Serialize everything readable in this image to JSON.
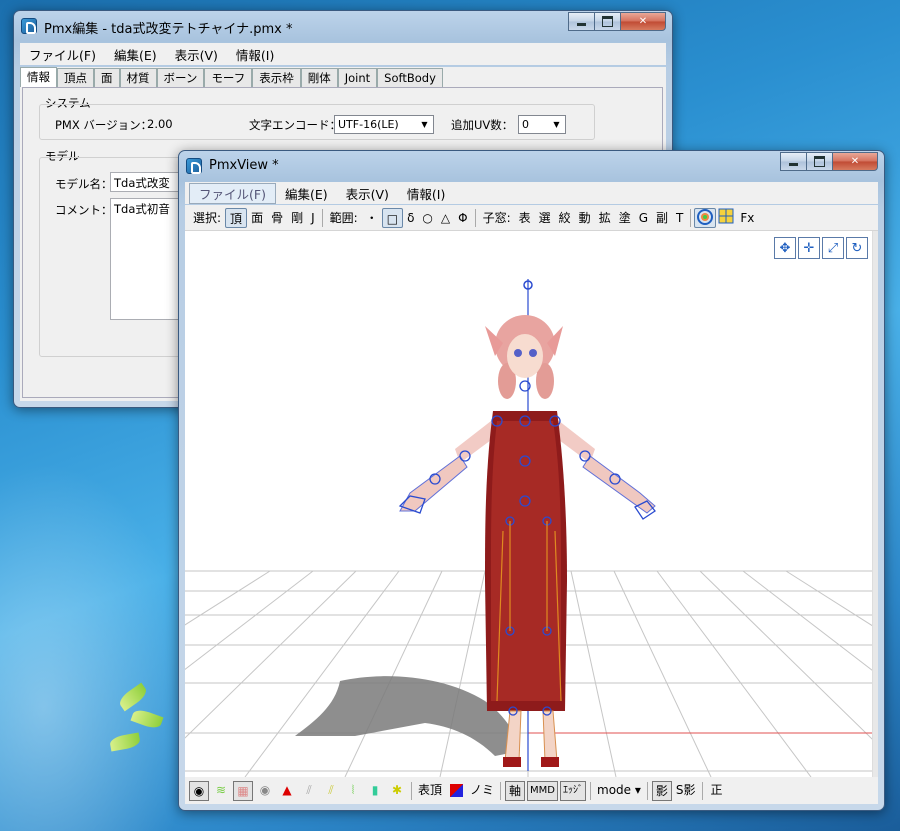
{
  "editor": {
    "title": "Pmx編集 - tda式改変テトチャイナ.pmx *",
    "menu": [
      "ファイル(F)",
      "編集(E)",
      "表示(V)",
      "情報(I)"
    ],
    "tabs": [
      "情報",
      "頂点",
      "面",
      "材質",
      "ボーン",
      "モーフ",
      "表示枠",
      "剛体",
      "Joint",
      "SoftBody"
    ],
    "system_group": "システム",
    "pmx_version_label": "PMX バージョン：",
    "pmx_version_value": "2.00",
    "encoding_label": "文字エンコード：",
    "encoding_value": "UTF-16(LE)",
    "uv_label": "追加UV数：",
    "uv_value": "0",
    "model_group": "モデル",
    "model_name_label": "モデル名：",
    "model_name_value": "Tda式改変",
    "comment_label": "コメント：",
    "comment_value": "Tda式初音"
  },
  "viewer": {
    "title": "PmxView *",
    "menu": [
      "ファイル(F)",
      "編集(E)",
      "表示(V)",
      "情報(I)"
    ],
    "toolbar": {
      "select_label": "選択:",
      "select_items": [
        "頂",
        "面",
        "骨",
        "剛",
        "J"
      ],
      "range_label": "範囲:",
      "range_items": [
        "・",
        "□",
        "δ",
        "○",
        "△",
        "Φ"
      ],
      "child_label": "子窓:",
      "child_items": [
        "表",
        "選",
        "絞",
        "動",
        "拡",
        "塗",
        "G",
        "副",
        "T"
      ],
      "fx_label": "Fx"
    },
    "bottombar": {
      "surface_label": "表頂",
      "nomi_label": "ノミ",
      "axis_label": "軸",
      "mmd_label": "MMD",
      "edge_label": "ｴｯｼﾞ",
      "mode_label": "mode ▾",
      "shadow_label": "影",
      "sshadow_label": "S影",
      "front_label": "正"
    }
  },
  "colors": {
    "accent": "#1f5fc0",
    "close_button": "#c04a33",
    "desktop": "#2a8fd0"
  }
}
